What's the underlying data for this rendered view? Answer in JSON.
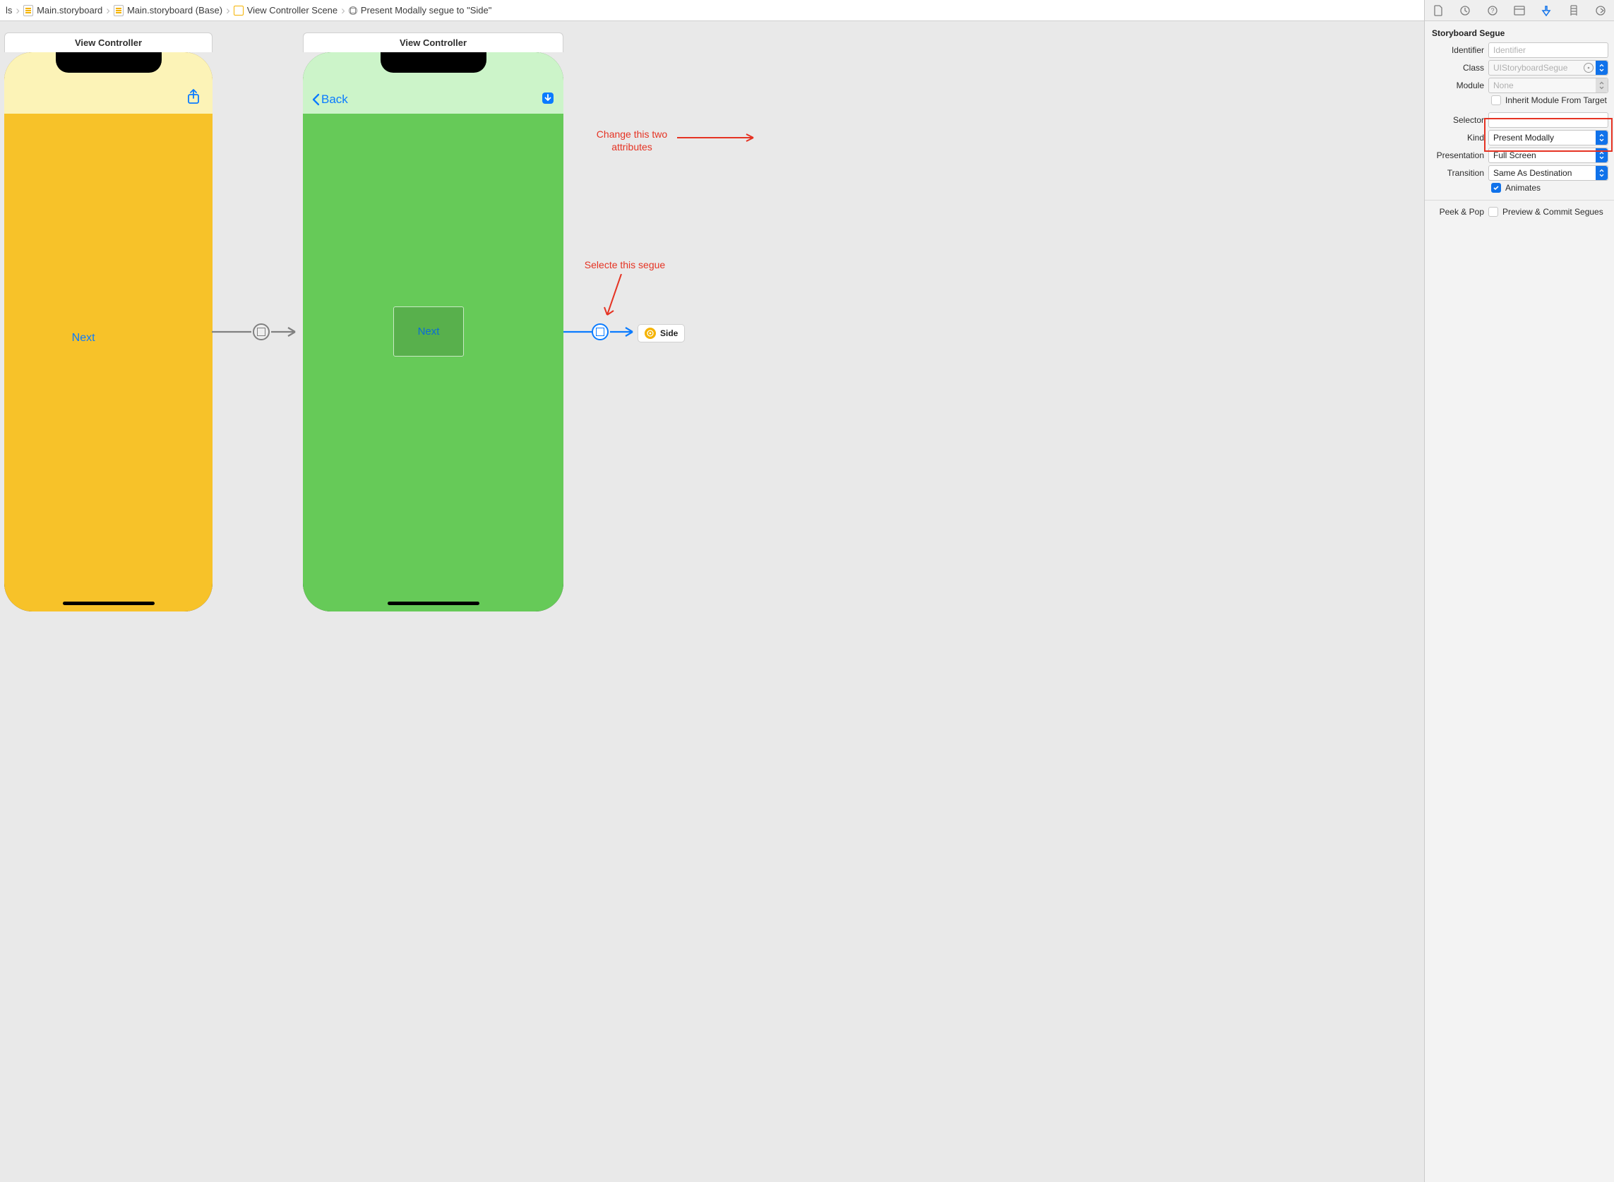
{
  "breadcrumbs": {
    "item0": "ls",
    "item1": "Main.storyboard",
    "item2": "Main.storyboard (Base)",
    "item3": "View Controller Scene",
    "item4": "Present Modally segue to \"Side\""
  },
  "canvas": {
    "sceneA_title": "View Controller",
    "sceneA_next": "Next",
    "sceneB_title": "View Controller",
    "sceneB_back": "Back",
    "sceneB_next": "Next",
    "sideRef": "Side"
  },
  "annotations": {
    "attrs_line1": "Change this two",
    "attrs_line2": "attributes",
    "segue": "Selecte this segue"
  },
  "inspector": {
    "section_title": "Storyboard Segue",
    "labels": {
      "identifier": "Identifier",
      "class": "Class",
      "module": "Module",
      "inherit": "Inherit Module From Target",
      "selector": "Selector",
      "kind": "Kind",
      "presentation": "Presentation",
      "transition": "Transition",
      "animates": "Animates",
      "peek": "Peek & Pop",
      "peek_val": "Preview & Commit Segues"
    },
    "values": {
      "identifier_ph": "Identifier",
      "class_ph": "UIStoryboardSegue",
      "module": "None",
      "kind": "Present Modally",
      "presentation": "Full Screen",
      "transition": "Same As Destination"
    }
  }
}
